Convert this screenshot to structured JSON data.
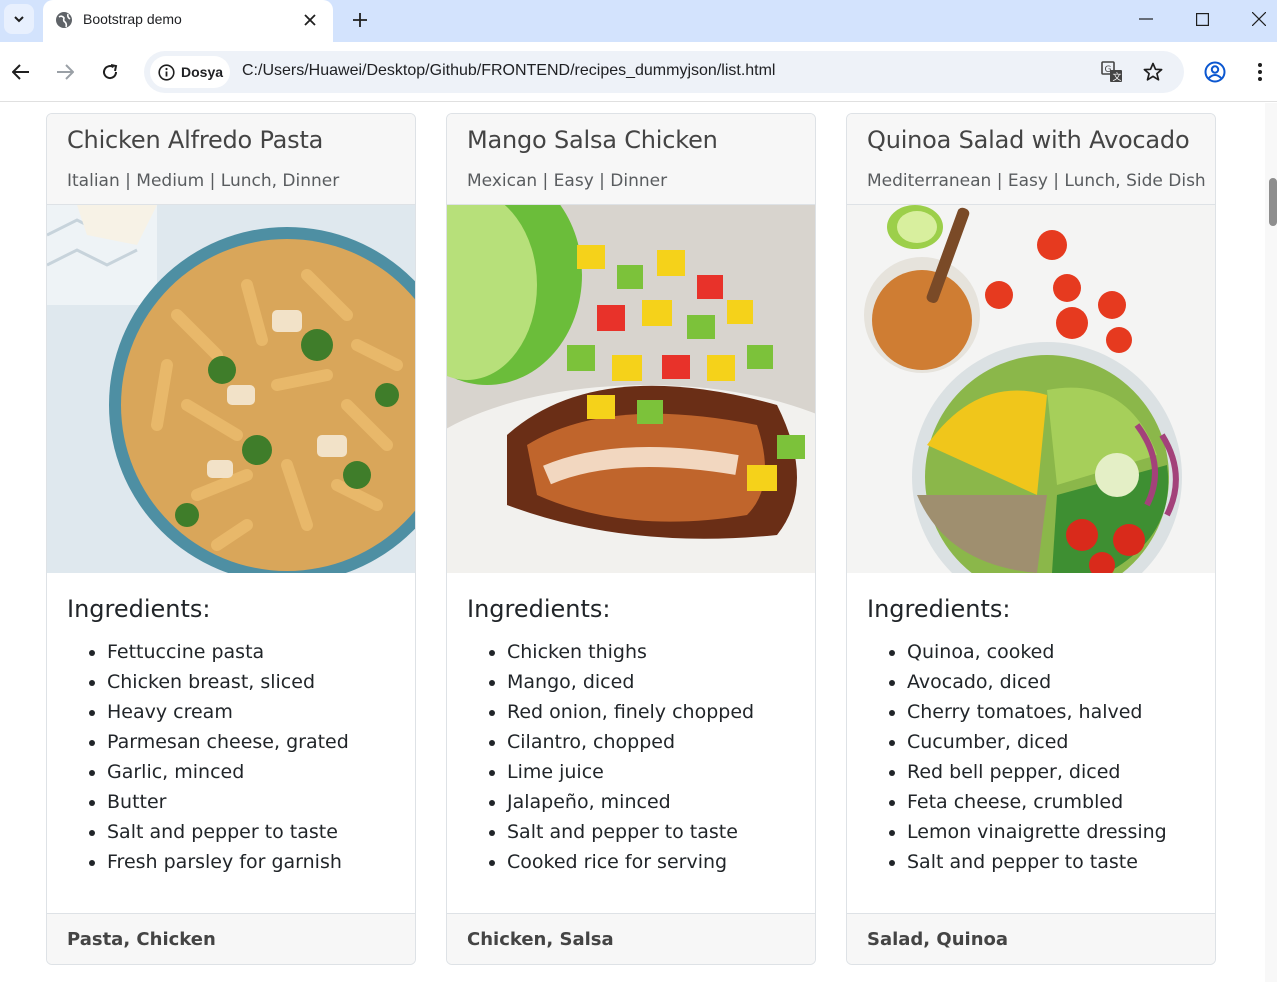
{
  "browser": {
    "tab_title": "Bootstrap demo",
    "site_chip": "Dosya",
    "url": "C:/Users/Huawei/Desktop/Github/FRONTEND/recipes_dummyjson/list.html",
    "icons": [
      "tab-search-icon",
      "globe-icon",
      "close-icon",
      "plus-icon",
      "minimize-icon",
      "maximize-icon",
      "window-close-icon",
      "back-icon",
      "forward-icon",
      "reload-icon",
      "info-icon",
      "translate-icon",
      "star-icon",
      "profile-icon",
      "kebab-menu-icon"
    ]
  },
  "recipes": [
    {
      "title": "Chicken Alfredo Pasta",
      "subtitle": "Italian | Medium | Lunch, Dinner",
      "ingredients_heading": "Ingredients:",
      "ingredients": [
        "Fettuccine pasta",
        "Chicken breast, sliced",
        "Heavy cream",
        "Parmesan cheese, grated",
        "Garlic, minced",
        "Butter",
        "Salt and pepper to taste",
        "Fresh parsley for garnish"
      ],
      "tags": "Pasta, Chicken"
    },
    {
      "title": "Mango Salsa Chicken",
      "subtitle": "Mexican | Easy | Dinner",
      "ingredients_heading": "Ingredients:",
      "ingredients": [
        "Chicken thighs",
        "Mango, diced",
        "Red onion, finely chopped",
        "Cilantro, chopped",
        "Lime juice",
        "Jalapeño, minced",
        "Salt and pepper to taste",
        "Cooked rice for serving"
      ],
      "tags": "Chicken, Salsa"
    },
    {
      "title": "Quinoa Salad with Avocado",
      "subtitle": "Mediterranean | Easy | Lunch, Side Dish",
      "ingredients_heading": "Ingredients:",
      "ingredients": [
        "Quinoa, cooked",
        "Avocado, diced",
        "Cherry tomatoes, halved",
        "Cucumber, diced",
        "Red bell pepper, diced",
        "Feta cheese, crumbled",
        "Lemon vinaigrette dressing",
        "Salt and pepper to taste"
      ],
      "tags": "Salad, Quinoa"
    }
  ]
}
